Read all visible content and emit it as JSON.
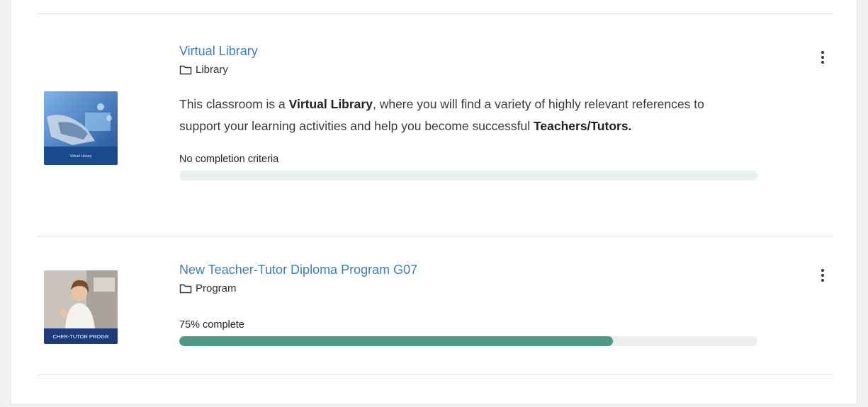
{
  "courses": [
    {
      "title": "Virtual Library",
      "category": "Library",
      "summary_before": "This classroom is a ",
      "summary_bold": "Virtual Library",
      "summary_middle": ", where you will find a variety of highly relevant references to support your learning activities and help you become successful ",
      "summary_bold2": "Teachers/Tutors.",
      "progress_label": "No completion criteria",
      "progress_percent": 0,
      "thumbnail_caption": "Virtual Library"
    },
    {
      "title": "New Teacher-Tutor Diploma Program G07",
      "category": "Program",
      "progress_label": "75% complete",
      "progress_percent": 75,
      "thumbnail_caption": "CHER-TUTOR PROGR"
    }
  ],
  "colors": {
    "link": "#3c7fc0",
    "progress_fill": "#4e9a86",
    "progress_track": "#eceff0"
  },
  "icons": {
    "category": "folder-icon",
    "actions": "more-vertical-icon"
  }
}
